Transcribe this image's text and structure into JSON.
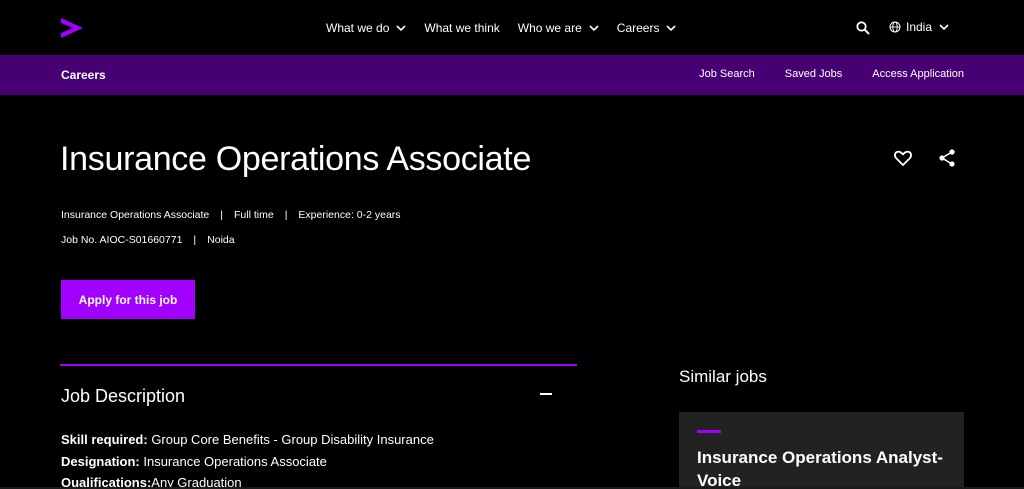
{
  "topnav": {
    "items": [
      "What we do",
      "What we think",
      "Who we are",
      "Careers"
    ],
    "region": "India",
    "logo_icon": "accenture-arrow-logo"
  },
  "careers_bar": {
    "title": "Careers",
    "links": [
      "Job Search",
      "Saved Jobs",
      "Access Application"
    ]
  },
  "job": {
    "title": "Insurance Operations Associate",
    "meta1": [
      "Insurance Operations Associate",
      "Full time",
      "Experience: 0-2 years"
    ],
    "meta2": [
      "Job No. AIOC-S01660771",
      "Noida"
    ],
    "apply_label": "Apply for this job"
  },
  "description": {
    "title": "Job Description",
    "lines": [
      {
        "label": "Skill required:",
        "value": " Group Core Benefits - Group Disability Insurance"
      },
      {
        "label": "Designation:",
        "value": " Insurance Operations Associate"
      },
      {
        "label": "Qualifications:",
        "value": "Any Graduation"
      }
    ]
  },
  "similar": {
    "title": "Similar jobs",
    "card_title": "Insurance Operations Analyst-Voice"
  },
  "colors": {
    "accent": "#a100ff",
    "careers_bar": "#460073",
    "background": "#000000"
  }
}
